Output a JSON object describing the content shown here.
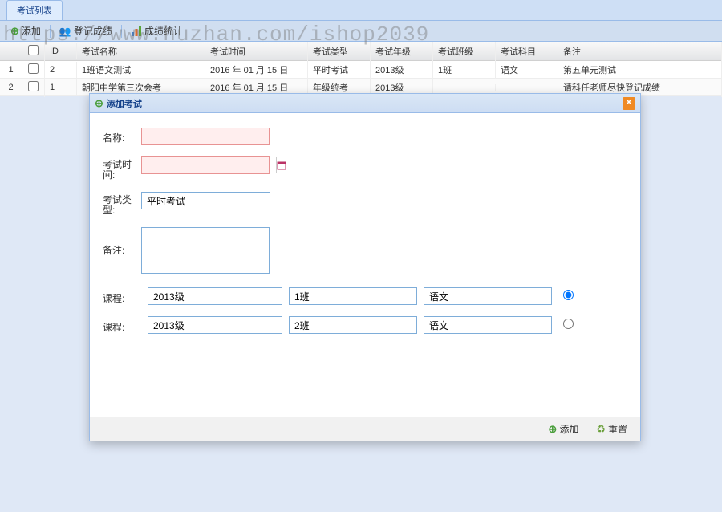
{
  "tab": {
    "title": "考试列表"
  },
  "toolbar": {
    "add": "添加",
    "score": "登记成绩",
    "stat": "成绩统计"
  },
  "grid": {
    "headers": {
      "id": "ID",
      "name": "考试名称",
      "time": "考试时间",
      "type": "考试类型",
      "grade": "考试年级",
      "class": "考试班级",
      "subject": "考试科目",
      "remark": "备注"
    },
    "rows": [
      {
        "num": "1",
        "id": "2",
        "name": "1班语文测试",
        "time": "2016 年 01 月 15 日",
        "type": "平时考试",
        "grade": "2013级",
        "class": "1班",
        "subject": "语文",
        "remark": "第五单元测试"
      },
      {
        "num": "2",
        "id": "1",
        "name": "朝阳中学第三次会考",
        "time": "2016 年 01 月 15 日",
        "type": "年级统考",
        "grade": "2013级",
        "class": "",
        "subject": "",
        "remark": "请科任老师尽快登记成绩"
      }
    ]
  },
  "dialog": {
    "title": "添加考试",
    "labels": {
      "name": "名称:",
      "time": "考试时间:",
      "type": "考试类型:",
      "remark": "备注:",
      "course": "课程:"
    },
    "fields": {
      "name": "",
      "time": "",
      "type": "平时考试",
      "remark": ""
    },
    "courses": [
      {
        "grade": "2013级",
        "class": "1班",
        "subject": "语文",
        "selected": true
      },
      {
        "grade": "2013级",
        "class": "2班",
        "subject": "语文",
        "selected": false
      }
    ],
    "buttons": {
      "add": "添加",
      "reset": "重置"
    }
  },
  "watermark": "https://www.huzhan.com/ishop2039"
}
